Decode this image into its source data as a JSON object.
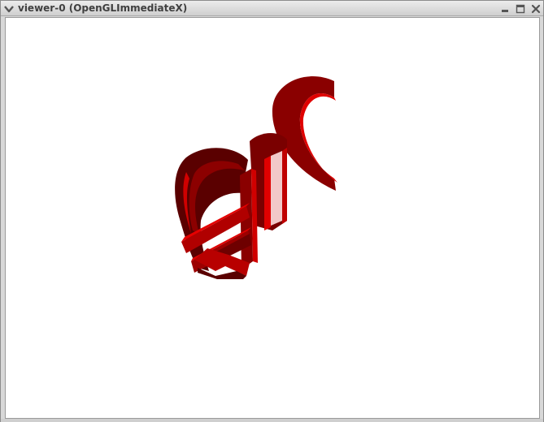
{
  "window": {
    "title": "viewer-0 (OpenGLImmediateX)"
  },
  "icons": {
    "menu": "chevron-down-icon",
    "minimize": "minimize-icon",
    "maximize": "maximize-icon",
    "close": "close-icon"
  },
  "colors": {
    "background": "#ffffff",
    "model_dark": "#5a0000",
    "model_mid": "#9e0000",
    "model_bright": "#e00000",
    "highlight": "#f2c8c8"
  }
}
